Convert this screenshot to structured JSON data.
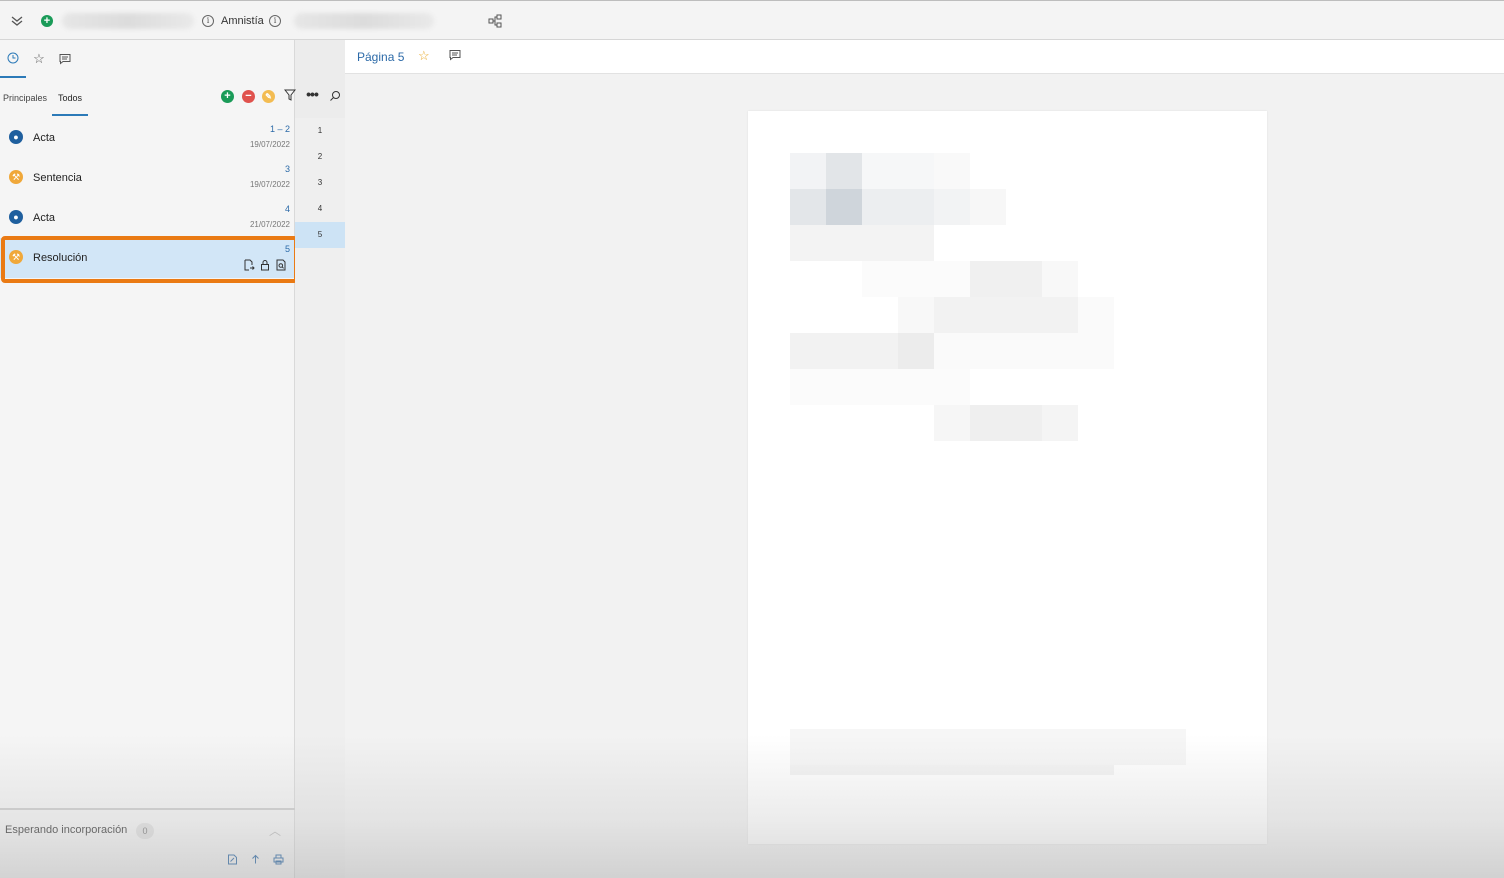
{
  "topbar": {
    "case_label": "Amnistía",
    "icons": [
      "chevron-double-down-icon",
      "add-icon",
      "info-icon",
      "info-icon",
      "share-tree-icon"
    ]
  },
  "sidebar": {
    "icon_tabs": [
      "history-icon",
      "star-icon",
      "comment-icon"
    ],
    "tabs": [
      {
        "label": "Principales"
      },
      {
        "label": "Todos"
      }
    ],
    "actions": [
      "add-icon",
      "remove-icon",
      "edit-icon",
      "filter-icon",
      "more-icon",
      "search-icon"
    ],
    "documents": [
      {
        "name": "Acta",
        "pages": "1 – 2",
        "date": "19/07/2022",
        "color": "#1f5f9e"
      },
      {
        "name": "Sentencia",
        "pages": "3",
        "date": "19/07/2022",
        "color": "#f0a83a"
      },
      {
        "name": "Acta",
        "pages": "4",
        "date": "21/07/2022",
        "color": "#1f5f9e"
      },
      {
        "name": "Resolución",
        "pages": "5",
        "date": "",
        "color": "#f0a83a"
      }
    ],
    "page_numbers": [
      "1",
      "2",
      "3",
      "4",
      "5"
    ],
    "waiting": {
      "label": "Esperando incorporación",
      "count": "0"
    }
  },
  "viewer": {
    "title": "Página 5"
  },
  "colors": {
    "accent": "#2c7ab8",
    "highlight": "#ea7a14",
    "selected": "#d2e6f7"
  }
}
